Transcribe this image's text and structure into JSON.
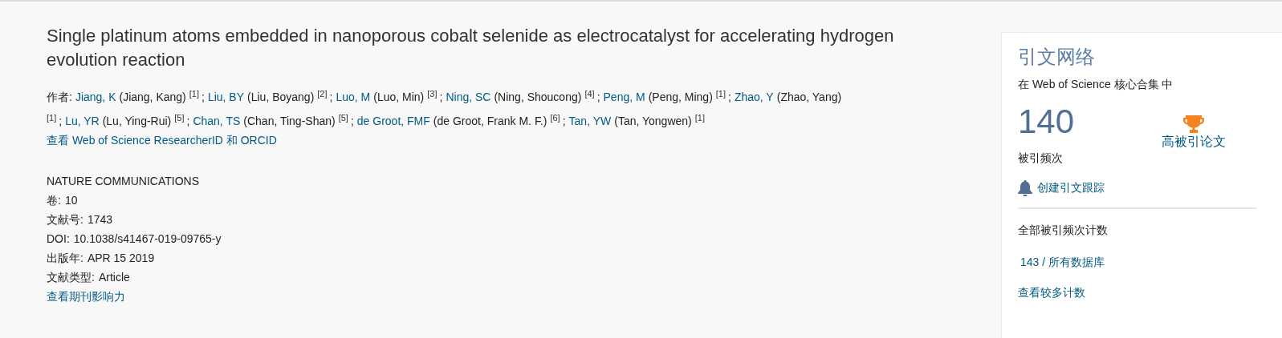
{
  "title": "Single platinum atoms embedded in nanoporous cobalt selenide as electrocatalyst for accelerating hydrogen evolution reaction",
  "authors_label": "作者:",
  "separator": ";",
  "authors": [
    {
      "short": "Jiang, K",
      "full": "(Jiang, Kang)",
      "aff": "[1]"
    },
    {
      "short": "Liu, BY",
      "full": "(Liu, Boyang)",
      "aff": "[2]"
    },
    {
      "short": "Luo, M",
      "full": "(Luo, Min)",
      "aff": "[3]"
    },
    {
      "short": "Ning, SC",
      "full": "(Ning, Shoucong)",
      "aff": "[4]"
    },
    {
      "short": "Peng, M",
      "full": "(Peng, Ming)",
      "aff": "[1]"
    },
    {
      "short": "Zhao, Y",
      "full": "(Zhao, Yang)",
      "aff": "[1]"
    },
    {
      "short": "Lu, YR",
      "full": "(Lu, Ying-Rui)",
      "aff": "[5]"
    },
    {
      "short": "Chan, TS",
      "full": "(Chan, Ting-Shan)",
      "aff": "[5]"
    },
    {
      "short": "de Groot, FMF",
      "full": "(de Groot, Frank M. F.)",
      "aff": "[6]"
    },
    {
      "short": "Tan, YW",
      "full": "(Tan, Yongwen)",
      "aff": "[1]"
    }
  ],
  "researcher_link": "查看 Web of Science ResearcherID 和 ORCID",
  "journal": "NATURE COMMUNICATIONS",
  "fields": [
    {
      "label": "卷:",
      "value": "10"
    },
    {
      "label": "文献号:",
      "value": "1743"
    },
    {
      "label": "DOI:",
      "value": "10.1038/s41467-019-09765-y"
    },
    {
      "label": "出版年:",
      "value": "APR 15 2019"
    },
    {
      "label": "文献类型:",
      "value": "Article"
    }
  ],
  "impact_link": "查看期刊影响力",
  "sidebar": {
    "title": "引文网络",
    "subtitle": "在 Web of Science 核心合集 中",
    "count": "140",
    "count_label": "被引频次",
    "highly_cited": "高被引论文",
    "alert_link": "创建引文跟踪",
    "all_label": "全部被引频次计数",
    "all_link": "143 / 所有数据库",
    "more_link": "查看较多计数"
  }
}
